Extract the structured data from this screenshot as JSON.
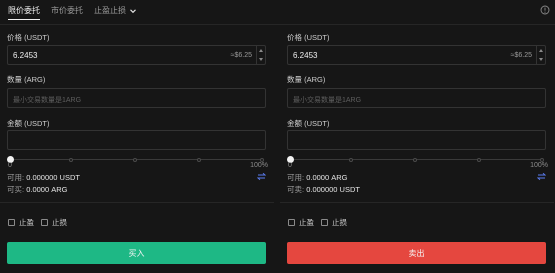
{
  "tabs": [
    {
      "label": "限价委托"
    },
    {
      "label": "市价委托"
    },
    {
      "label": "止盈止损"
    }
  ],
  "buy": {
    "price_label": "价格 (USDT)",
    "price_value": "6.2453",
    "price_approx": "≈$6.25",
    "amount_label": "数量 (ARG)",
    "amount_placeholder": "最小交易数量是1ARG",
    "total_label": "金额 (USDT)",
    "slider_min": "0",
    "slider_max": "100%",
    "slider_percent": 0,
    "available_label": "可用:",
    "available_value": "0.000000 USDT",
    "can_buy_label": "可买:",
    "can_buy_value": "0.0000 ARG",
    "take_profit": "止盈",
    "stop_loss": "止损",
    "action": "买入"
  },
  "sell": {
    "price_label": "价格 (USDT)",
    "price_value": "6.2453",
    "price_approx": "≈$6.25",
    "amount_label": "数量 (ARG)",
    "amount_placeholder": "最小交易数量是1ARG",
    "total_label": "金额 (USDT)",
    "slider_min": "0",
    "slider_max": "100%",
    "slider_percent": 0,
    "available_label": "可用:",
    "available_value": "0.0000 ARG",
    "can_sell_label": "可卖:",
    "can_sell_value": "0.000000 USDT",
    "take_profit": "止盈",
    "stop_loss": "止损",
    "action": "卖出"
  },
  "colors": {
    "buy": "#1eb885",
    "sell": "#e5473f",
    "swap": "#5b7cf0"
  }
}
